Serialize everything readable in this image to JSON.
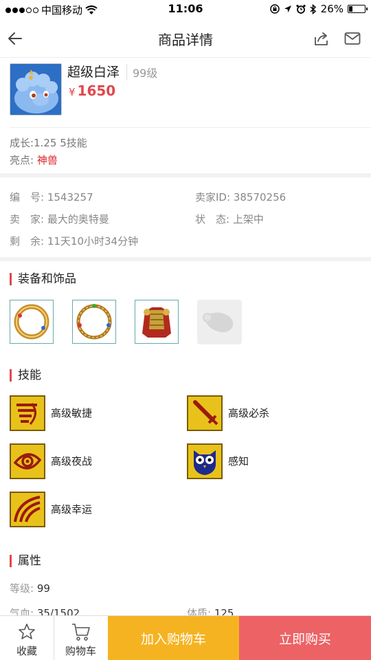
{
  "status_bar": {
    "carrier": "中国移动",
    "time": "11:06",
    "battery": "26%",
    "battery_level": 0.26
  },
  "nav": {
    "title": "商品详情"
  },
  "product": {
    "name": "超级白泽",
    "level": "99级",
    "currency": "¥",
    "price": "1650",
    "growth": "成长:1.25 5技能",
    "highlight_label": "亮点:",
    "highlight_value": "神兽"
  },
  "info": {
    "id_label": "编　号:",
    "id_value": "1543257",
    "seller_id_label": "卖家ID:",
    "seller_id_value": "38570256",
    "seller_label": "卖　家:",
    "seller_value": "最大的奥特曼",
    "state_label": "状　态:",
    "state_value": "上架中",
    "remain_label": "剩　余:",
    "remain_value": "11天10小时34分钟"
  },
  "equipment": {
    "title": "装备和饰品",
    "items": [
      "ring-gold-icon",
      "necklace-gold-icon",
      "armor-icon",
      "empty-slot-icon"
    ]
  },
  "skills": {
    "title": "技能",
    "items": [
      {
        "label": "高级敏捷",
        "icon": "agility-icon"
      },
      {
        "label": "高级必杀",
        "icon": "sword-icon"
      },
      {
        "label": "高级夜战",
        "icon": "eye-icon"
      },
      {
        "label": "感知",
        "icon": "owl-icon"
      },
      {
        "label": "高级幸运",
        "icon": "luck-icon"
      }
    ]
  },
  "attributes": {
    "title": "属性",
    "level_label": "等级:",
    "level_value": "99",
    "hp_label": "气血:",
    "hp_value": "35/1502",
    "con_label": "体质:",
    "con_value": "125"
  },
  "bottom": {
    "favorite": "收藏",
    "cart": "购物车",
    "add_to_cart": "加入购物车",
    "buy_now": "立即购买"
  },
  "colors": {
    "accent_red": "#e0484c",
    "cart_button": "#f5b321",
    "buy_button": "#ec6265"
  }
}
